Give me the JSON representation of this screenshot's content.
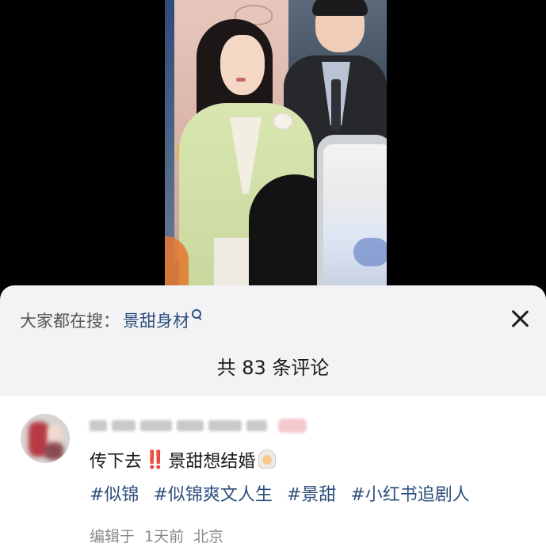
{
  "hot_search": {
    "prefix": "大家都在搜：",
    "term": "景甜身材"
  },
  "comments_header": {
    "count_text": "共 83 条评论"
  },
  "comment": {
    "text_before": "传下去",
    "emphasis": "‼️",
    "text_after": "景甜想结婚",
    "emoji_icon": "bride-with-veil-icon",
    "tags": [
      "#似锦",
      "#似锦爽文人生",
      "#景甜",
      "#小红书追剧人"
    ],
    "meta": {
      "prefix": "编辑于",
      "time": "1天前",
      "location": "北京"
    }
  },
  "colors": {
    "link_blue": "#2e4f7d",
    "sheet_bg": "#f3f3f5",
    "emphasis_red": "#e0243a"
  }
}
